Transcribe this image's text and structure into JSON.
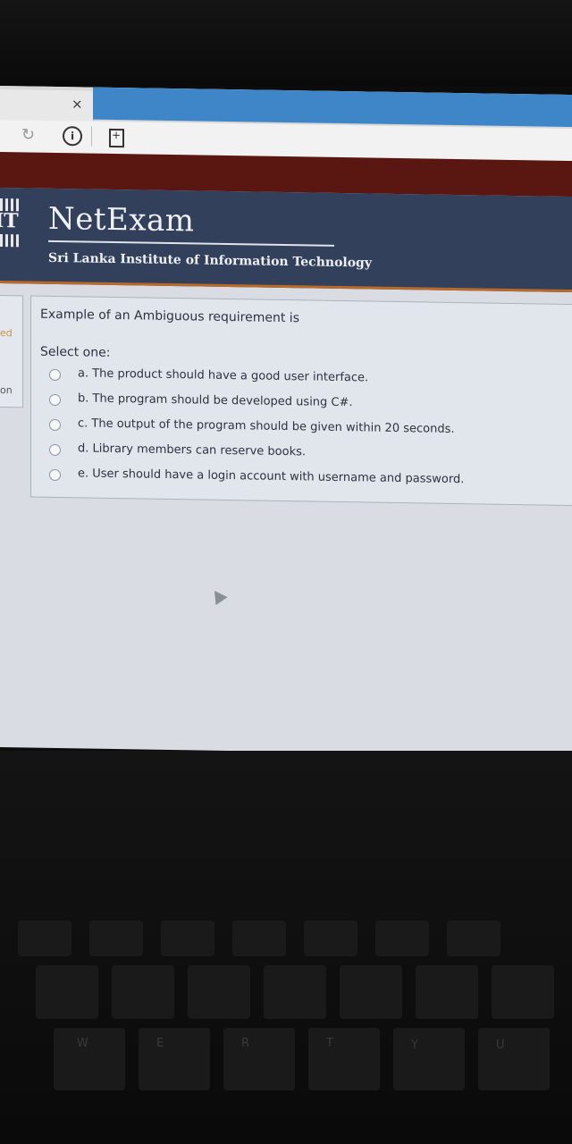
{
  "browser": {
    "tab_close": "×"
  },
  "site": {
    "logo_letters": "IT",
    "brand": "NetExam",
    "institute": "Sri Lanka Institute of Information Technology"
  },
  "sidebar_fragments": {
    "frag1": "ed",
    "frag2": "on"
  },
  "question": {
    "prompt": "Example of an Ambiguous requirement is",
    "select_label": "Select one:",
    "options": [
      "a. The product should have a good user interface.",
      "b. The program should be developed using C#.",
      "c. The output of the program should be given within 20 seconds.",
      "d. Library members can reserve books.",
      "e. User should have a login account with username and password."
    ]
  },
  "keyboard": {
    "keys": [
      "W",
      "E",
      "R",
      "T",
      "Y",
      "U"
    ]
  }
}
